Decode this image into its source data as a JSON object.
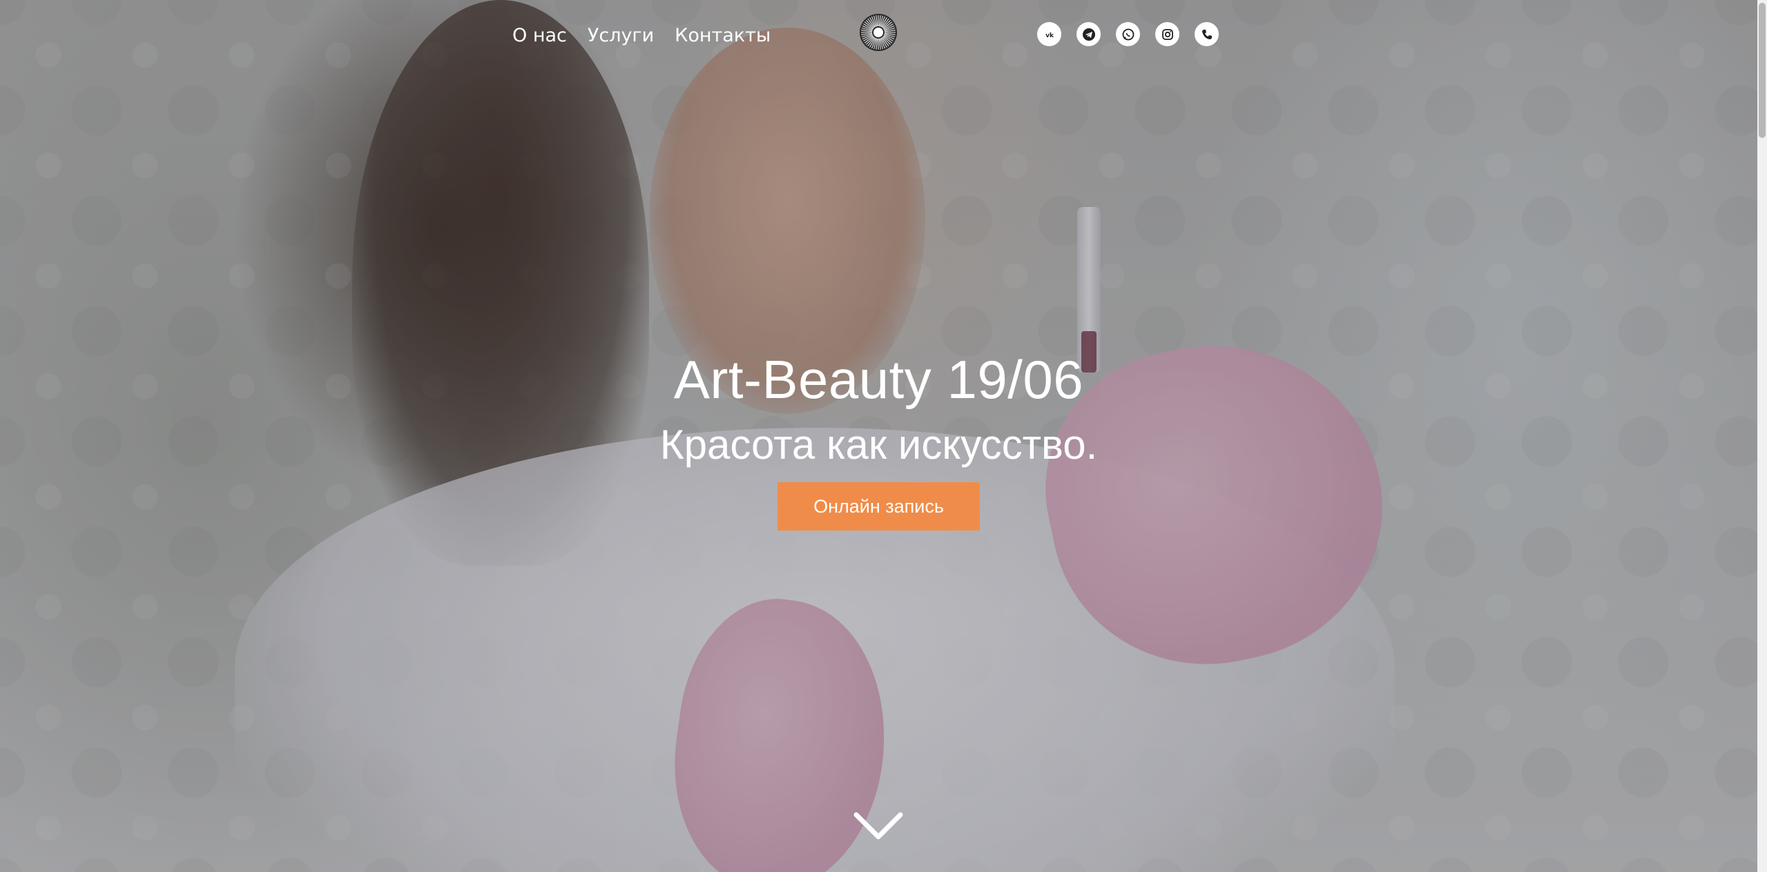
{
  "nav": {
    "links": [
      {
        "label": "О нас"
      },
      {
        "label": "Услуги"
      },
      {
        "label": "Контакты"
      }
    ],
    "logo_icon": "sunburst-logo-icon"
  },
  "socials": [
    {
      "icon": "vk-icon"
    },
    {
      "icon": "telegram-icon"
    },
    {
      "icon": "whatsapp-icon"
    },
    {
      "icon": "instagram-icon"
    },
    {
      "icon": "phone-icon"
    }
  ],
  "hero": {
    "title": "Art-Beauty 19/06",
    "subtitle": "Красота как искусство.",
    "cta_label": "Онлайн запись",
    "scroll_icon": "chevron-down-icon"
  },
  "colors": {
    "accent": "#f08c49",
    "text": "#ffffff"
  }
}
